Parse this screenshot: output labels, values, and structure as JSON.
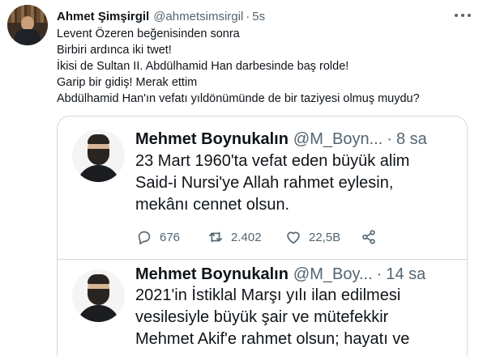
{
  "tweet": {
    "author_name": "Ahmet Şimşirgil",
    "author_handle": "@ahmetsimsirgil",
    "separator": "·",
    "time": "5s",
    "lines": [
      "Levent Özeren beğenisinden sonra",
      "Birbiri ardınca iki twet!",
      "İkisi de Sultan II. Abdülhamid Han darbesinde baş rolde!",
      "Garip bir gidiş! Merak ettim",
      "Abdülhamid Han'ın vefatı yıldönümünde de bir taziyesi olmuş muydu?"
    ]
  },
  "quoted": [
    {
      "author_name": "Mehmet Boynukalın",
      "author_handle": "@M_Boyn...",
      "separator": "·",
      "time": "8 sa",
      "lines": [
        "23 Mart 1960'ta vefat eden büyük alim",
        "Said-i Nursi'ye Allah rahmet eylesin,",
        "mekânı cennet olsun."
      ],
      "replies": "676",
      "retweets": "2.402",
      "likes": "22,5B"
    },
    {
      "author_name": "Mehmet Boynukalın",
      "author_handle": "@M_Boy...",
      "separator": "·",
      "time": "14 sa",
      "lines": [
        "2021'in İstiklal Marşı yılı ilan edilmesi",
        "vesilesiyle büyük şair ve mütefekkir",
        "Mehmet Akif'e rahmet olsun; hayatı ve"
      ]
    }
  ],
  "icons": {
    "more": "more-icon",
    "reply": "reply-icon",
    "retweet": "retweet-icon",
    "like": "heart-icon",
    "share": "share-icon"
  },
  "colors": {
    "text": "#0f1419",
    "secondary": "#536471",
    "border": "#cfd9de"
  }
}
